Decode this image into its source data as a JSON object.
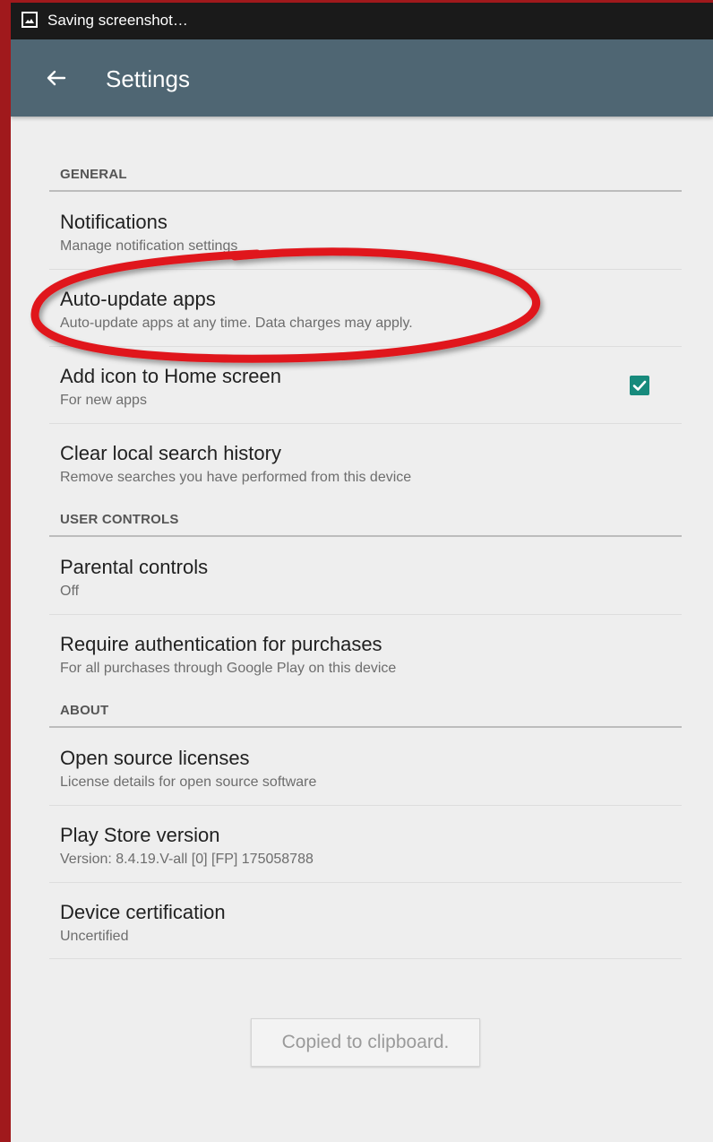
{
  "status_bar": {
    "text": "Saving screenshot…",
    "icon": "screenshot-icon"
  },
  "app_bar": {
    "title": "Settings",
    "back_icon": "arrow-back-icon",
    "color": "#4f6673"
  },
  "sections": {
    "general": {
      "label": "GENERAL",
      "items": [
        {
          "title": "Notifications",
          "subtitle": "Manage notification settings"
        },
        {
          "title": "Auto-update apps",
          "subtitle": "Auto-update apps at any time. Data charges may apply."
        },
        {
          "title": "Add icon to Home screen",
          "subtitle": "For new apps",
          "checked": true
        },
        {
          "title": "Clear local search history",
          "subtitle": "Remove searches you have performed from this device"
        }
      ]
    },
    "user_controls": {
      "label": "USER CONTROLS",
      "items": [
        {
          "title": "Parental controls",
          "subtitle": "Off"
        },
        {
          "title": "Require authentication for purchases",
          "subtitle": "For all purchases through Google Play on this device"
        }
      ]
    },
    "about": {
      "label": "ABOUT",
      "items": [
        {
          "title": "Open source licenses",
          "subtitle": "License details for open source software"
        },
        {
          "title": "Play Store version",
          "subtitle": "Version: 8.4.19.V-all [0] [FP] 175058788"
        },
        {
          "title": "Device certification",
          "subtitle": "Uncertified"
        }
      ]
    }
  },
  "toast": {
    "text": "Copied to clipboard."
  },
  "colors": {
    "accent": "#178a7c",
    "annotation": "#e0161b",
    "frame": "#a0191c"
  }
}
